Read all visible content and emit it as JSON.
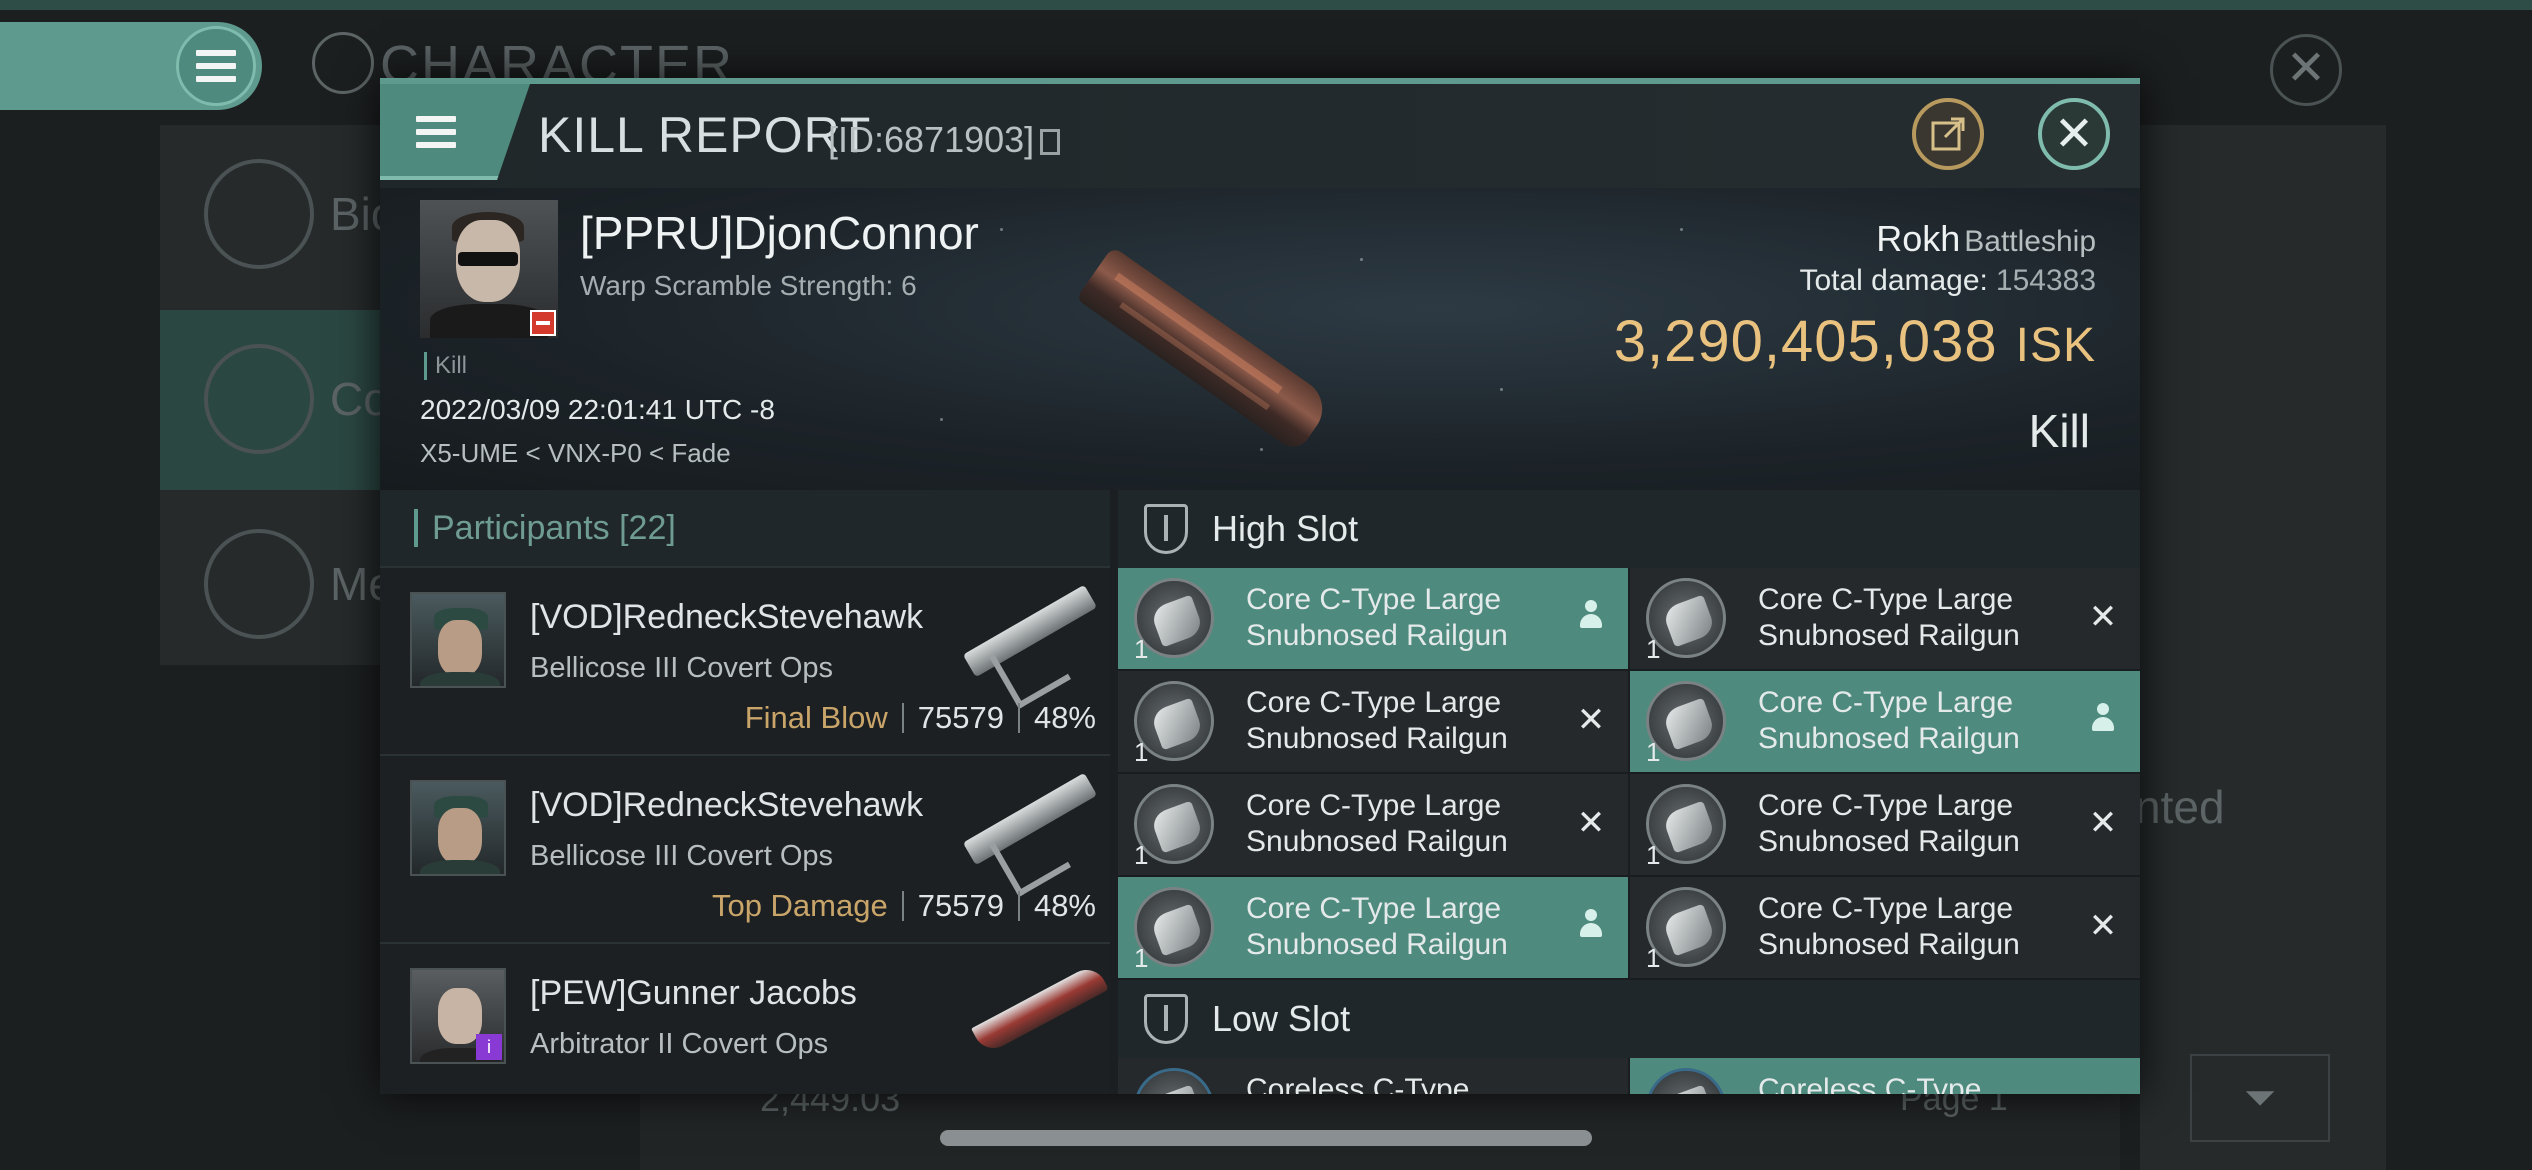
{
  "background": {
    "title": "CHARACTER",
    "sidebar_labels": [
      "Bio",
      "Co",
      "Me"
    ],
    "partial_text": "nted",
    "bottom_value": "2,449.03",
    "bottom_page": "Page 1"
  },
  "window": {
    "title": "KILL REPORT",
    "id": "[ID:6871903]"
  },
  "victim": {
    "name": "[PPRU]DjonConnor",
    "subtitle": "Warp Scramble Strength: 6",
    "kill_label": "Kill",
    "datetime": "2022/03/09 22:01:41 UTC -8",
    "location": "X5-UME < VNX-P0 < Fade",
    "ship_name": "Rokh",
    "ship_class": "Battleship",
    "total_damage_label": "Total damage:",
    "total_damage": "154383",
    "isk_value": "3,290,405,038",
    "isk_unit": "ISK",
    "report_type": "Kill"
  },
  "participants": {
    "header": "Participants",
    "count": "[22]",
    "rows": [
      {
        "name": "[VOD]RedneckStevehawk",
        "ship": "Bellicose III Covert Ops",
        "role": "Final Blow",
        "damage": "75579",
        "percent": "48%"
      },
      {
        "name": "[VOD]RedneckStevehawk",
        "ship": "Bellicose III Covert Ops",
        "role": "Top Damage",
        "damage": "75579",
        "percent": "48%"
      },
      {
        "name": "[PEW]Gunner Jacobs",
        "ship": "Arbitrator II Covert Ops",
        "role": "",
        "damage": "",
        "percent": ""
      }
    ]
  },
  "fitting": {
    "high_slot_label": "High Slot",
    "low_slot_label": "Low Slot",
    "high_slots": [
      {
        "qty": "1",
        "line1": "Core C-Type Large",
        "line2": "Snubnosed Railgun",
        "state": "dropped"
      },
      {
        "qty": "1",
        "line1": "Core C-Type Large",
        "line2": "Snubnosed Railgun",
        "state": "destroyed"
      },
      {
        "qty": "1",
        "line1": "Core C-Type Large",
        "line2": "Snubnosed Railgun",
        "state": "destroyed"
      },
      {
        "qty": "1",
        "line1": "Core C-Type Large",
        "line2": "Snubnosed Railgun",
        "state": "dropped"
      },
      {
        "qty": "1",
        "line1": "Core C-Type Large",
        "line2": "Snubnosed Railgun",
        "state": "destroyed"
      },
      {
        "qty": "1",
        "line1": "Core C-Type Large",
        "line2": "Snubnosed Railgun",
        "state": "destroyed"
      },
      {
        "qty": "1",
        "line1": "Core C-Type Large",
        "line2": "Snubnosed Railgun",
        "state": "dropped"
      },
      {
        "qty": "1",
        "line1": "Core C-Type Large",
        "line2": "Snubnosed Railgun",
        "state": "destroyed"
      }
    ],
    "low_peek": [
      "Coreless C-Type",
      "Coreless C-Type"
    ]
  },
  "icons": {
    "menu": "hamburger-icon",
    "share": "external-link-icon",
    "close": "close-icon",
    "copy": "copy-icon",
    "destroyed": "x-icon",
    "dropped": "person-icon"
  },
  "colors": {
    "accent": "#5e9a8d",
    "isk": "#e8c27e",
    "role": "#c9a56a",
    "dropped_bg": "#4e8a7e",
    "destroyed_bg": "#25292b"
  }
}
